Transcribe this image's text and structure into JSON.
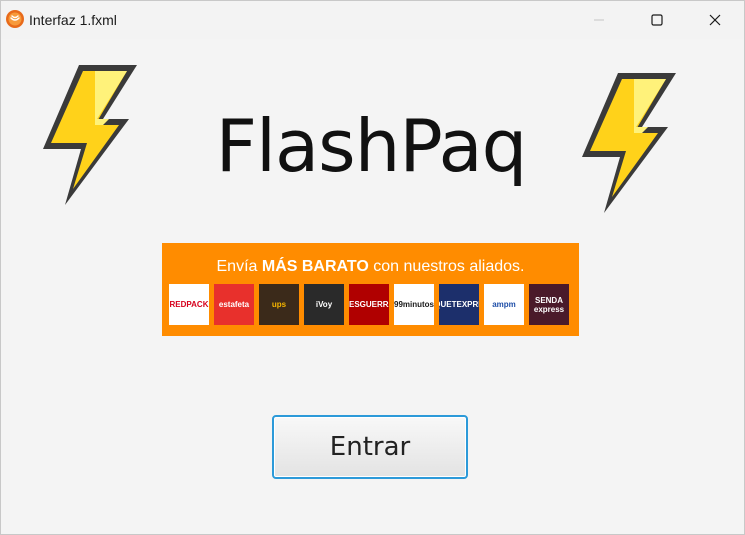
{
  "window": {
    "title": "Interfaz 1.fxml",
    "app_icon": "java-app-icon",
    "controls": [
      "minimize-icon",
      "maximize-icon",
      "close-icon"
    ]
  },
  "main": {
    "brand": "FlashPaq",
    "left_icon": "lightning-bolt-icon",
    "right_icon": "lightning-bolt-icon",
    "banner": {
      "text_prefix": "Envía ",
      "text_bold": "MÁS BARATO",
      "text_suffix": " con nuestros aliados.",
      "background": "#ff8c00",
      "carriers": [
        {
          "name": "REDPACK",
          "bg": "#ffffff",
          "fg": "#d6001c"
        },
        {
          "name": "estafeta",
          "bg": "#e8302c",
          "fg": "#ffffff"
        },
        {
          "name": "ups",
          "bg": "#3b2a1a",
          "fg": "#f4b400"
        },
        {
          "name": "iVoy",
          "bg": "#2a2a2a",
          "fg": "#ffffff"
        },
        {
          "name": "TRESGUERRAS",
          "bg": "#b00000",
          "fg": "#ffffff"
        },
        {
          "name": "99minutos",
          "bg": "#ffffff",
          "fg": "#1a1a1a"
        },
        {
          "name": "PAQUETEXPRESS",
          "bg": "#1c2f6b",
          "fg": "#ffffff"
        },
        {
          "name": "ampm",
          "bg": "#ffffff",
          "fg": "#1f4fa8"
        },
        {
          "name": "SENDA express",
          "bg": "#4a1a2a",
          "fg": "#ffffff"
        }
      ]
    },
    "enter_label": "Entrar"
  }
}
